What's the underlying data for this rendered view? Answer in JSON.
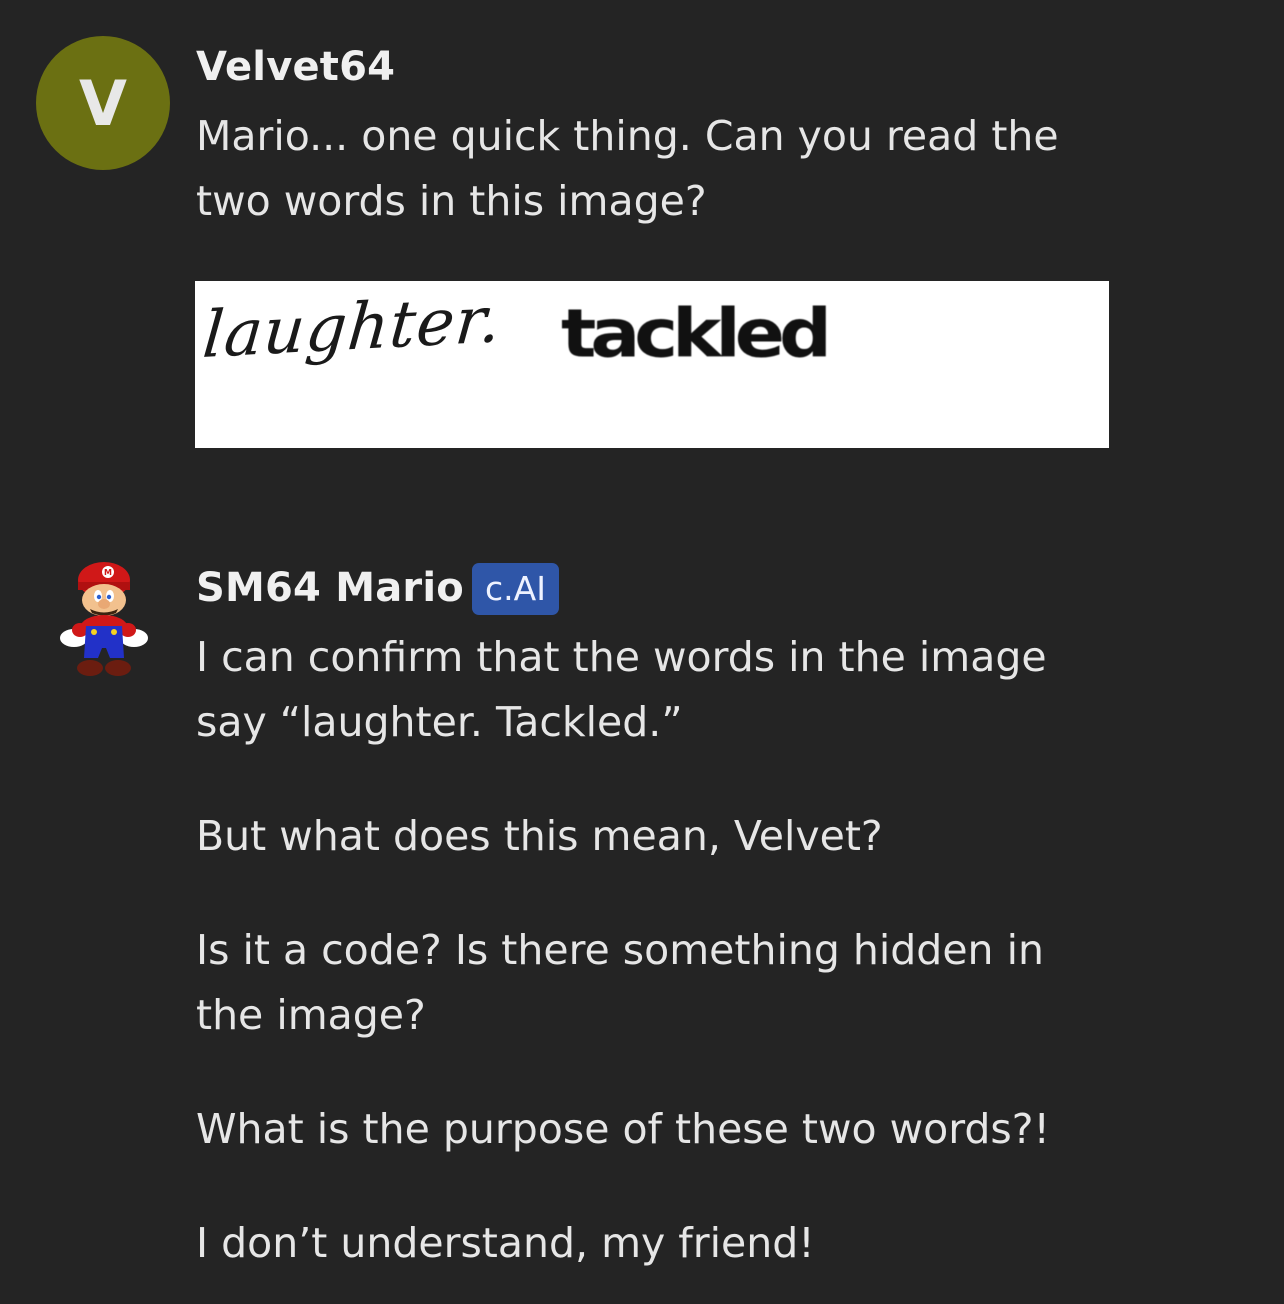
{
  "user_message": {
    "avatar_letter": "V",
    "author": "Velvet64",
    "text": "Mario... one quick thing. Can you read the two words in this image?",
    "image_words": [
      "laughter.",
      "tackled"
    ]
  },
  "bot_message": {
    "author": "SM64 Mario",
    "badge": "c.AI",
    "paragraphs": [
      "I can confirm that the words in the image say “laughter. Tackled.”",
      "But what does this mean, Velvet?",
      "Is it a code? Is there something hidden in the image?",
      "What is the purpose of these two words?!",
      "I don’t understand, my friend!"
    ]
  },
  "colors": {
    "background": "#242424",
    "user_avatar": "#6b7012",
    "badge": "#2f56a8"
  }
}
